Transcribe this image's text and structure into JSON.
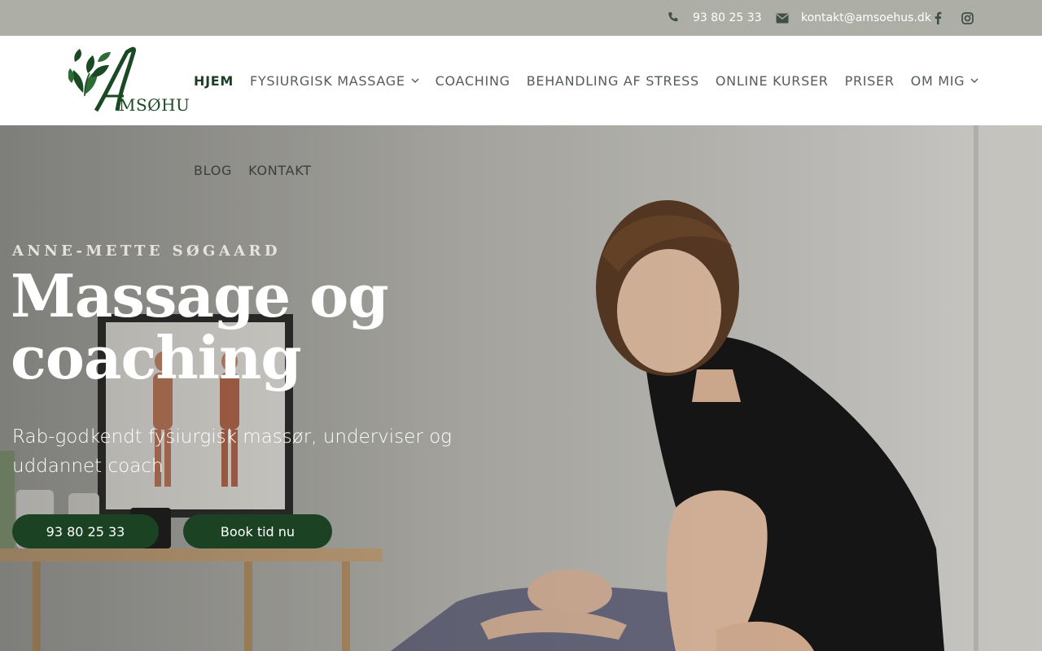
{
  "topbar": {
    "phone": "93 80 25 33",
    "email": "kontakt@amsoehus.dk",
    "icons": [
      "phone-icon",
      "envelope-icon",
      "facebook-icon",
      "instagram-icon"
    ]
  },
  "brand": {
    "logo_text": "AMSØHUS",
    "colors": {
      "primary_green": "#1c4224",
      "topbar": "#adafa6",
      "nav_text": "#555d58"
    }
  },
  "nav": {
    "items": [
      {
        "label": "HJEM",
        "active": true
      },
      {
        "label": "FYSIURGISK MASSAGE",
        "dropdown": true
      },
      {
        "label": "COACHING"
      },
      {
        "label": "BEHANDLING AF STRESS"
      },
      {
        "label": "ONLINE KURSER"
      },
      {
        "label": "PRISER"
      },
      {
        "label": "OM MIG",
        "dropdown": true
      },
      {
        "label": "BLOG"
      },
      {
        "label": "KONTAKT"
      }
    ]
  },
  "hero": {
    "eyebrow": "ANNE-METTE SØGAARD",
    "title_line1": "Massage og",
    "title_line2": "coaching",
    "subtitle": "Rab-godkendt fysiurgisk massør, underviser og uddannet coach",
    "buttons": {
      "phone_label": "93 80 25 33",
      "book_label": "Book tid nu"
    }
  }
}
